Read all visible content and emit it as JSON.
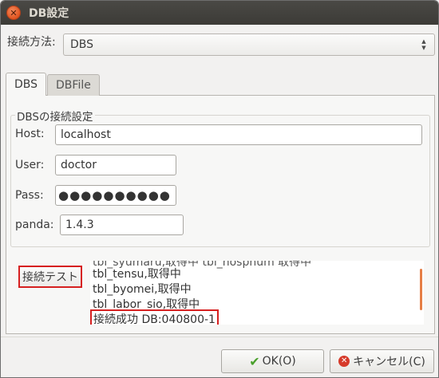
{
  "window": {
    "title": "DB設定"
  },
  "connection": {
    "label": "接続方法:",
    "value": "DBS"
  },
  "tabs": [
    {
      "label": "DBS"
    },
    {
      "label": "DBFile"
    }
  ],
  "group": {
    "title": "DBSの接続設定",
    "host": {
      "label": "Host:",
      "value": "localhost"
    },
    "user": {
      "label": "User:",
      "value": "doctor"
    },
    "pass": {
      "label": "Pass:",
      "value": "●●●●●●●●●●"
    },
    "panda": {
      "label": "panda:",
      "value": "1.4.3"
    }
  },
  "test": {
    "button_label": "接続テスト",
    "log": {
      "partial": "tbl_syumaru,取得中 tbl_hospnum 取得中",
      "line1": "tbl_tensu,取得中",
      "line2": "tbl_byomei,取得中",
      "line3": "tbl_labor_sio,取得中",
      "result": "接続成功 DB:040800-1"
    }
  },
  "buttons": {
    "ok": "OK(O)",
    "cancel": "キャンセル(C)"
  },
  "icons": {
    "close": "close-icon",
    "ok": "check-icon",
    "cancel": "cancel-icon",
    "select": "updown-arrow-icon"
  },
  "colors": {
    "highlight": "#d62020",
    "titlebar": "#3c3b37",
    "scroll": "#e67e45"
  }
}
